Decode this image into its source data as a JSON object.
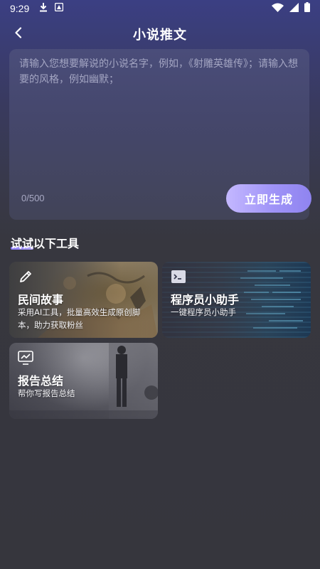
{
  "status_bar": {
    "time": "9:29",
    "left_icons": [
      "download-icon",
      "app-notification-icon"
    ],
    "right_icons": [
      "wifi-icon",
      "signal-icon",
      "battery-icon"
    ]
  },
  "header": {
    "title": "小说推文",
    "back_icon": "chevron-left-icon"
  },
  "input": {
    "placeholder": "请输入您想要解说的小说名字，例如，《射雕英雄传》；请输入想要的风格，例如幽默；",
    "value": "",
    "char_count": "0/500",
    "generate_label": "立即生成"
  },
  "tools_section": {
    "title": "试试以下工具",
    "cards": [
      {
        "title": "民间故事",
        "desc": "采用AI工具，批量高效生成原创脚本，助力获取粉丝",
        "icon": "pencil-icon"
      },
      {
        "title": "程序员小助手",
        "desc": "一键程序员小助手",
        "icon": "terminal-icon"
      },
      {
        "title": "报告总结",
        "desc": "帮你写报告总结",
        "icon": "chart-monitor-icon"
      }
    ]
  },
  "colors": {
    "accent_start": "#c4b8ff",
    "accent_end": "#8f84f0",
    "background": "#36363d"
  }
}
